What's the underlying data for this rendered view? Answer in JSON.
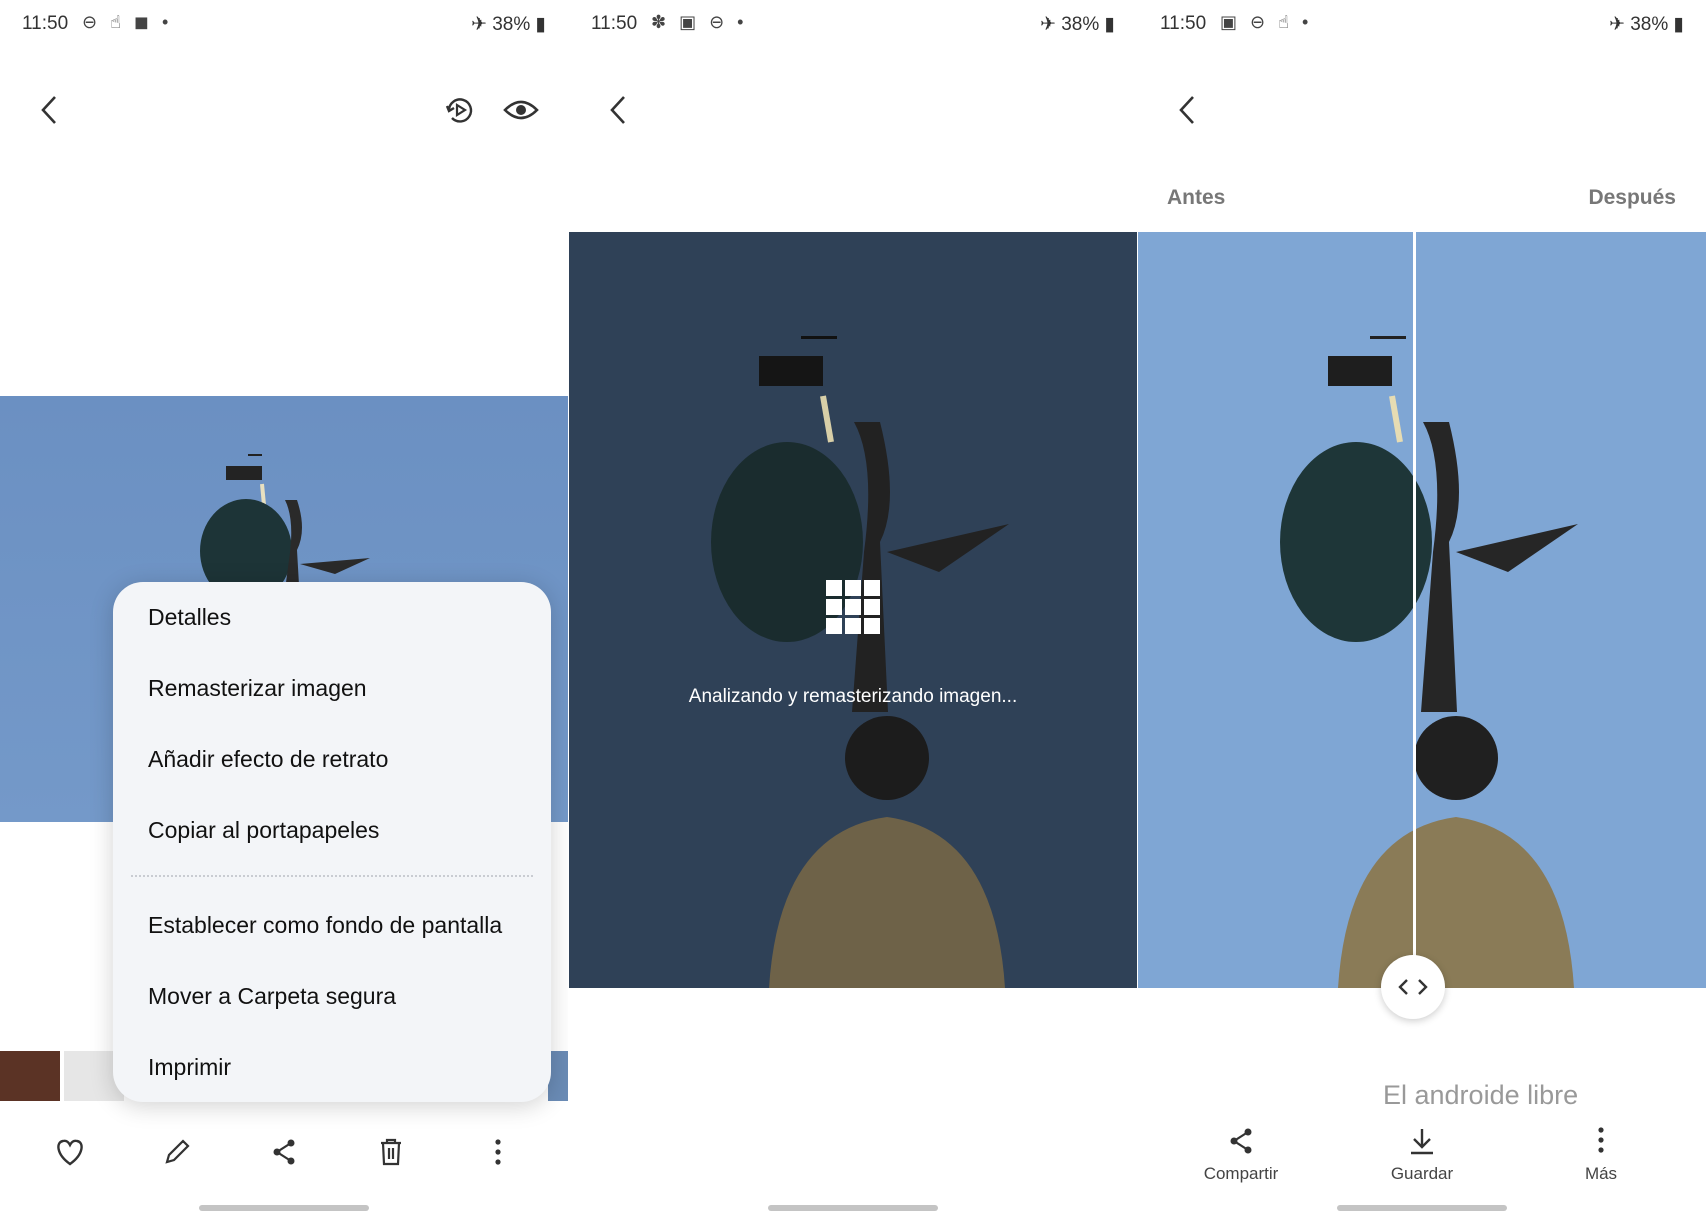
{
  "panels": [
    {
      "status": {
        "time": "11:50",
        "battery": "38%"
      },
      "top_icons": [
        "back-icon",
        "motion-photo-icon",
        "eye-icon"
      ],
      "menu": {
        "items": [
          "Detalles",
          "Remasterizar imagen",
          "Añadir efecto de retrato",
          "Copiar al portapapeles",
          "Establecer como fondo de pantalla",
          "Mover a Carpeta segura",
          "Imprimir"
        ]
      },
      "bottom_icons": [
        "heart-icon",
        "pencil-icon",
        "share-icon",
        "trash-icon",
        "more-vertical-icon"
      ]
    },
    {
      "status": {
        "time": "11:50",
        "battery": "38%"
      },
      "overlay_text": "Analizando y remasterizando imagen..."
    },
    {
      "status": {
        "time": "11:50",
        "battery": "38%"
      },
      "tabs": {
        "before": "Antes",
        "after": "Después"
      },
      "actions": {
        "share": "Compartir",
        "save": "Guardar",
        "more": "Más"
      },
      "watermark": "El androide libre"
    }
  ],
  "colors": {
    "sky": "#7499c9",
    "dark_overlay": "#2f4157",
    "menu_bg": "#f3f5f8"
  }
}
